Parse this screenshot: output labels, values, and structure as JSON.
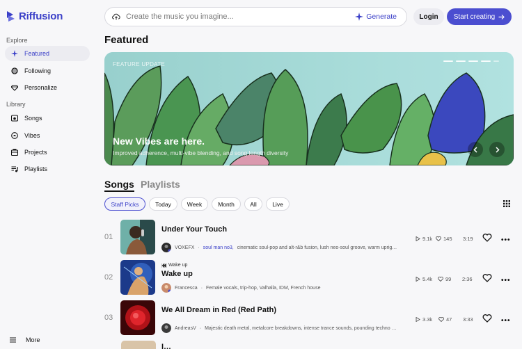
{
  "brand": {
    "name": "Riffusion",
    "accent": "#3b40c8"
  },
  "sidebar": {
    "explore_heading": "Explore",
    "explore_items": [
      {
        "label": "Featured",
        "icon": "sparkle-icon",
        "active": true
      },
      {
        "label": "Following",
        "icon": "following-icon",
        "active": false
      },
      {
        "label": "Personalize",
        "icon": "diamond-icon",
        "active": false
      }
    ],
    "library_heading": "Library",
    "library_items": [
      {
        "label": "Songs",
        "icon": "songs-icon"
      },
      {
        "label": "Vibes",
        "icon": "vibes-icon"
      },
      {
        "label": "Projects",
        "icon": "projects-icon"
      },
      {
        "label": "Playlists",
        "icon": "playlists-icon"
      }
    ],
    "more_label": "More"
  },
  "search": {
    "placeholder": "Create the music you imagine...",
    "generate_label": "Generate"
  },
  "header": {
    "login_label": "Login",
    "start_label": "Start creating"
  },
  "featured": {
    "title": "Featured",
    "banner": {
      "kicker": "FEATURE UPDATE",
      "title": "New Vibes are here.",
      "subtitle": "Improved adherence, multi-vibe blending, and song length diversity"
    }
  },
  "tabs": [
    {
      "label": "Songs",
      "active": true
    },
    {
      "label": "Playlists",
      "active": false
    }
  ],
  "filters": [
    "Staff Picks",
    "Today",
    "Week",
    "Month",
    "All",
    "Live"
  ],
  "active_filter": "Staff Picks",
  "songs": [
    {
      "rank": "01",
      "title": "Under Your Touch",
      "tag": "",
      "author": "VOXEFX",
      "sep": "·",
      "link": "soul man no3,",
      "description": "cinematic soul-pop and alt-r&b fusion, lush neo-soul groove, warm uprig…",
      "plays": "9.1k",
      "likes": "145",
      "duration": "3:19"
    },
    {
      "rank": "02",
      "title": "Wake up",
      "tag": "Wake up",
      "author": "Francesca",
      "sep": "·",
      "link": "",
      "description": "Female vocals, trip-hop, Valhalla, IDM, French house",
      "plays": "5.4k",
      "likes": "99",
      "duration": "2:36"
    },
    {
      "rank": "03",
      "title": "We All Dream in Red (Red Path)",
      "tag": "",
      "author": "AndreasV",
      "sep": "·",
      "link": "",
      "description": "Majestic death metal, metalcore breakdowns, intense trance sounds, pounding techno …",
      "plays": "3.3k",
      "likes": "47",
      "duration": "3:33"
    }
  ],
  "next_peek_title": "I…"
}
